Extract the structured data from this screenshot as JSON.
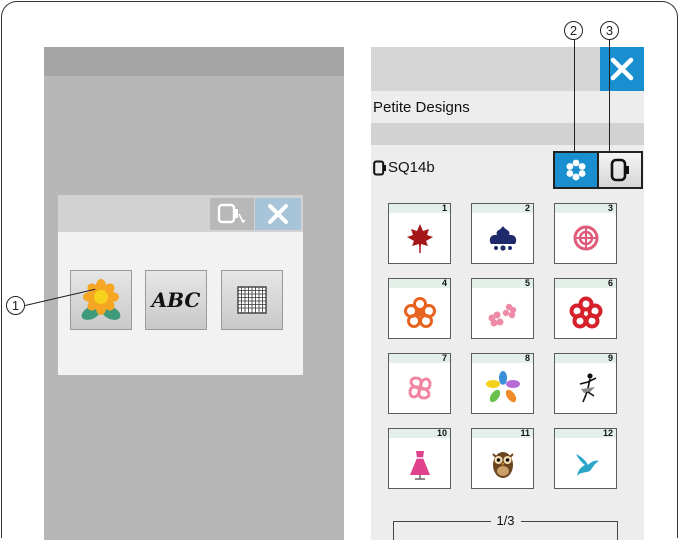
{
  "callouts": [
    "1",
    "2",
    "3"
  ],
  "left_screen": {
    "dialog": {
      "hoop_icon": "hoop-select-icon",
      "close_icon": "close-icon",
      "modes": [
        {
          "icon": "flower-design-icon"
        },
        {
          "label": "ABC"
        },
        {
          "icon": "grid-icon"
        }
      ]
    }
  },
  "right_screen": {
    "close_icon": "close-icon",
    "title": "Petite Designs",
    "hoop_label": "SQ14b",
    "toggle_embroidery_icon": "flower-icon",
    "toggle_hoop_icon": "hoop-icon",
    "designs": [
      {
        "number": "1",
        "motif": "maple-leaf",
        "color": "#a4161a"
      },
      {
        "number": "2",
        "motif": "damask",
        "color": "#1f2a6b"
      },
      {
        "number": "3",
        "motif": "lace-ball",
        "color": "#e05a7a"
      },
      {
        "number": "4",
        "motif": "orange-flower",
        "color": "#e8641e"
      },
      {
        "number": "5",
        "motif": "pink-blossoms",
        "color": "#ec8aa8"
      },
      {
        "number": "6",
        "motif": "red-flower",
        "color": "#d6202a"
      },
      {
        "number": "7",
        "motif": "pink-swirl-flower",
        "color": "#ef86a2"
      },
      {
        "number": "8",
        "motif": "rainbow-flower",
        "color": "#6ac04c"
      },
      {
        "number": "9",
        "motif": "ballerina",
        "color": "#111111"
      },
      {
        "number": "10",
        "motif": "pink-dress",
        "color": "#e0408c"
      },
      {
        "number": "11",
        "motif": "owl",
        "color": "#6b4520"
      },
      {
        "number": "12",
        "motif": "bird",
        "color": "#2aa6c9"
      }
    ],
    "page_indicator": "1/3"
  },
  "colors": {
    "accent_blue": "#1a8fd0",
    "left_background": "#b7b7b7",
    "right_background": "#ededed"
  }
}
